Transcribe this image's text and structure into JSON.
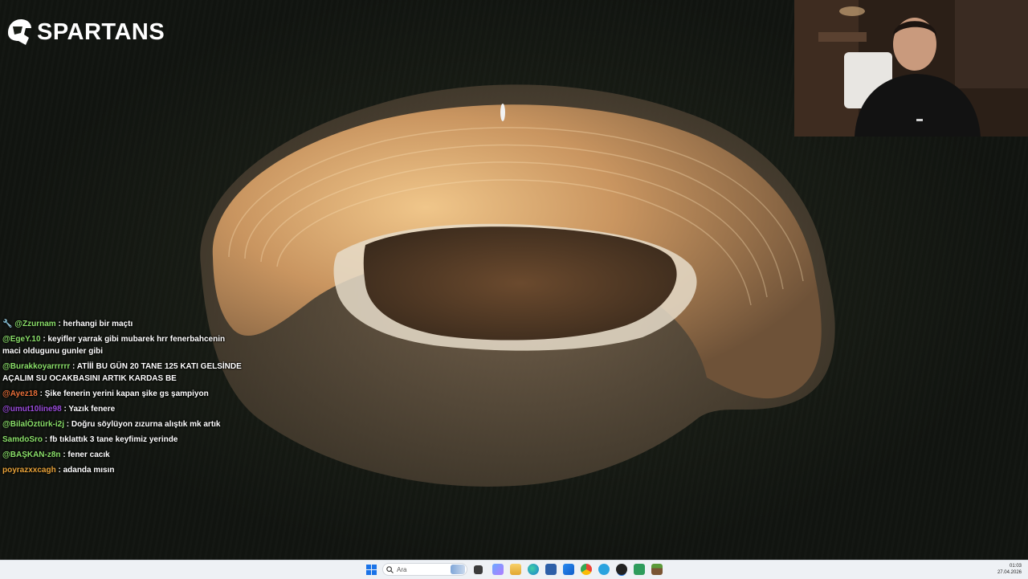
{
  "overlay": {
    "logo_text": "SPARTANS"
  },
  "chat": [
    {
      "user": "@Zzurnam",
      "text": ": herhangi bir maçtı",
      "color": "#8be06a",
      "badge": "wrench-icon"
    },
    {
      "user": "@EgeY.10",
      "text": ": keyifler yarrak gibi mubarek hrr fenerbahcenin maci oldugunu gunler gibi",
      "color": "#8be06a"
    },
    {
      "user": "@Burakkoyarrrrrr",
      "text": ": ATİİİ BU GÜN 20 TANE 125 KATI GELSİNDE AÇALIM SU OCAKBASINI ARTIK KARDAS BE",
      "color": "#8be06a"
    },
    {
      "user": "@Ayez18",
      "text": ": Şike fenerin yerini kapan şike gs şampiyon",
      "color": "#e8703a"
    },
    {
      "user": "@umut10line98",
      "text": ": Yazık fenere",
      "color": "#9a4ddb"
    },
    {
      "user": "@BilalÖztürk-i2j",
      "text": ": Doğru söylüyon zızurna alıştık mk artık",
      "color": "#8be06a"
    },
    {
      "user": "SamdoSro",
      "text": ": fb tıklattık 3 tane keyfimiz yerinde",
      "color": "#8be06a"
    },
    {
      "user": "@BAŞKAN-z8n",
      "text": ": fener cacık",
      "color": "#8be06a"
    },
    {
      "user": "poyrazxxcagh",
      "text": ": adanda mısın",
      "color": "#e8a33a"
    }
  ],
  "taskbar": {
    "search_placeholder": "Ara",
    "icons": [
      "start-icon",
      "search-icon",
      "task-view-icon",
      "widgets-icon",
      "file-explorer-icon",
      "edge-icon",
      "store-icon",
      "mail-icon",
      "chrome-icon",
      "telegram-icon",
      "obs-icon",
      "terminal-icon",
      "minecraft-icon"
    ],
    "time": "01:03",
    "date": "27.04.2026"
  }
}
